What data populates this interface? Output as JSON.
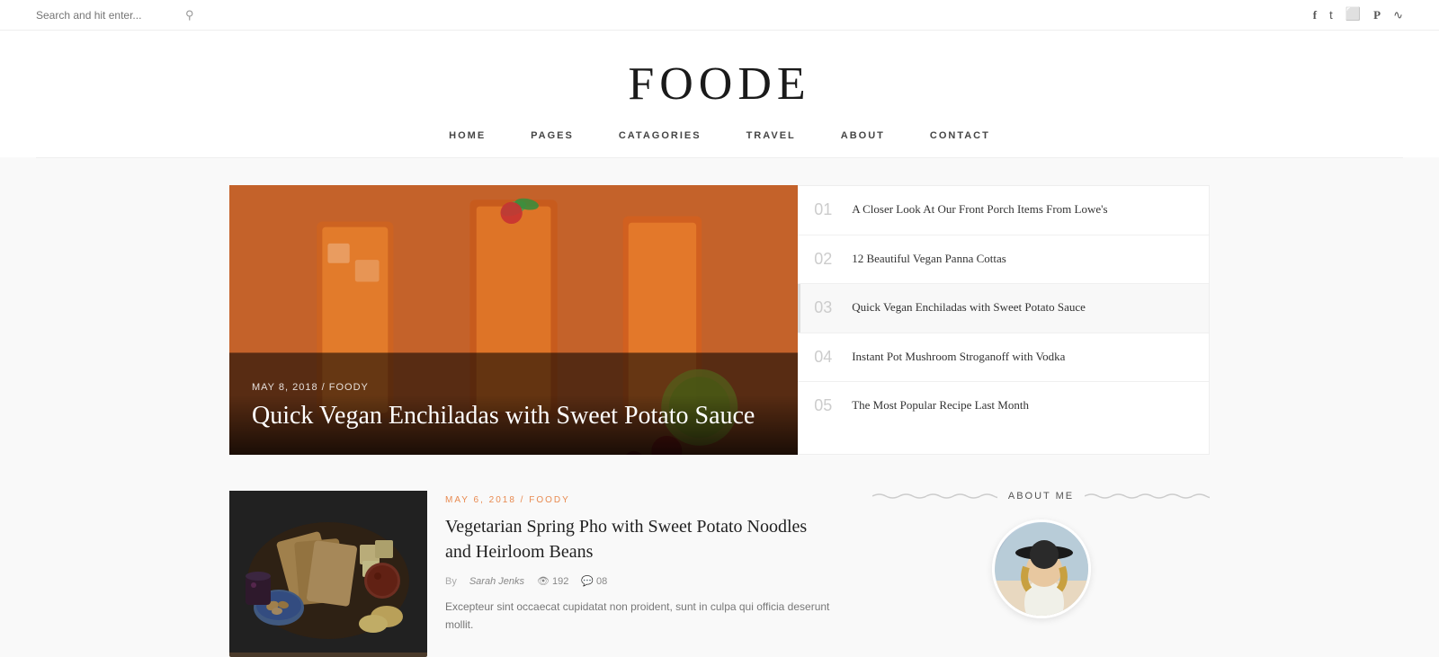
{
  "topbar": {
    "search_placeholder": "Search and hit enter...",
    "social": [
      "f",
      "t",
      "ig",
      "pin",
      "rss"
    ]
  },
  "header": {
    "logo": "FOODE"
  },
  "nav": {
    "items": [
      {
        "label": "HOME",
        "id": "home"
      },
      {
        "label": "PAGES",
        "id": "pages"
      },
      {
        "label": "CATAGORIES",
        "id": "categories"
      },
      {
        "label": "TRAVEL",
        "id": "travel"
      },
      {
        "label": "ABOUT",
        "id": "about"
      },
      {
        "label": "CONTACT",
        "id": "contact"
      }
    ]
  },
  "hero": {
    "meta": "MAY 8, 2018 / FOODY",
    "title": "Quick Vegan Enchiladas with Sweet Potato Sauce"
  },
  "sidebar_posts": [
    {
      "num": "01",
      "title": "A Closer Look At Our Front Porch Items From Lowe's"
    },
    {
      "num": "02",
      "title": "12 Beautiful Vegan Panna Cottas"
    },
    {
      "num": "03",
      "title": "Quick Vegan Enchiladas with Sweet Potato Sauce"
    },
    {
      "num": "04",
      "title": "Instant Pot Mushroom Stroganoff with Vodka"
    },
    {
      "num": "05",
      "title": "The Most Popular Recipe Last Month"
    }
  ],
  "post_card": {
    "date_category": "MAY 6, 2018 / FOODY",
    "title": "Vegetarian Spring Pho with Sweet Potato Noodles and Heirloom Beans",
    "by": "By",
    "author": "Sarah Jenks",
    "views": "192",
    "comments": "08",
    "excerpt": "Excepteur sint occaecat cupidatat non proident, sunt in culpa qui officia deserunt mollit."
  },
  "about": {
    "title": "ABOUT ME"
  },
  "icons": {
    "search": "🔍",
    "facebook": "f",
    "twitter": "𝕥",
    "instagram": "◻",
    "pinterest": "𝗽",
    "rss": "⊕",
    "eye": "👁",
    "comment": "💬"
  }
}
